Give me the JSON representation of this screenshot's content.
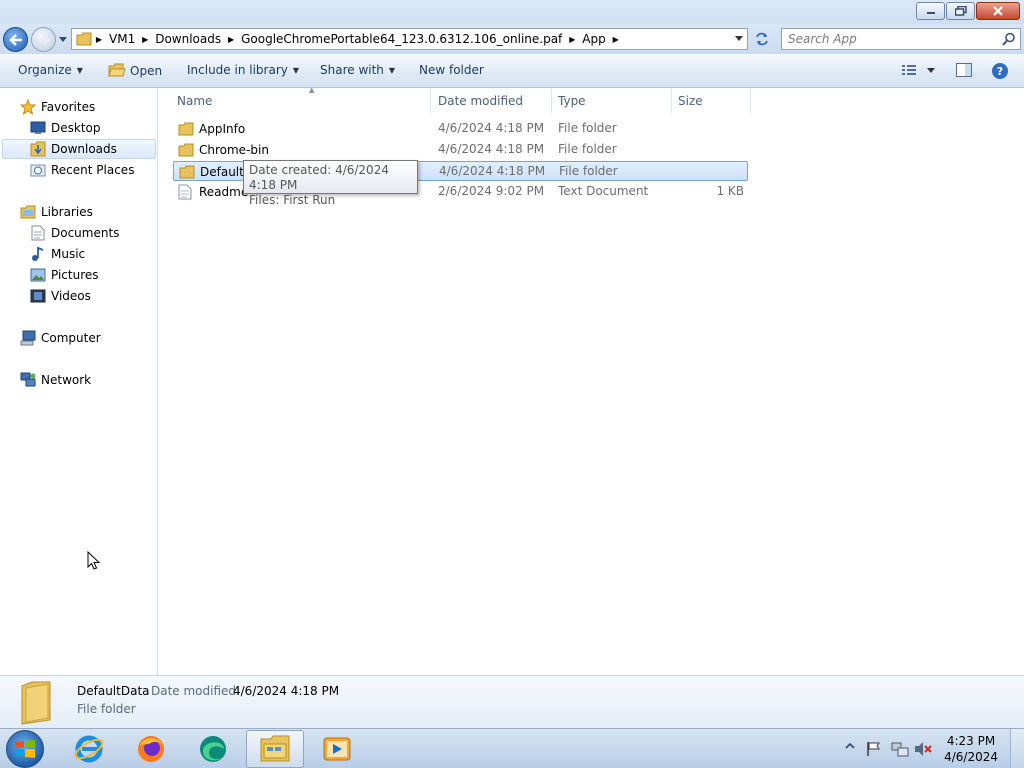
{
  "window": {
    "controls": {
      "minimize": "minimize-icon",
      "restore": "restore-icon",
      "close": "close-icon"
    }
  },
  "address": {
    "crumbs": [
      "VM1",
      "Downloads",
      "GoogleChromePortable64_123.0.6312.106_online.paf",
      "App"
    ]
  },
  "search": {
    "placeholder": "Search App"
  },
  "toolbar": {
    "organize": "Organize",
    "open": "Open",
    "include_in_library": "Include in library",
    "share_with": "Share with",
    "new_folder": "New folder"
  },
  "nav": {
    "favorites": "Favorites",
    "desktop": "Desktop",
    "downloads": "Downloads",
    "recent_places": "Recent Places",
    "libraries": "Libraries",
    "documents": "Documents",
    "music": "Music",
    "pictures": "Pictures",
    "videos": "Videos",
    "computer": "Computer",
    "network": "Network"
  },
  "columns": {
    "name": "Name",
    "date": "Date modified",
    "type": "Type",
    "size": "Size"
  },
  "files": [
    {
      "name": "AppInfo",
      "date": "4/6/2024 4:18 PM",
      "type": "File folder",
      "size": "",
      "icon": "folder-icon"
    },
    {
      "name": "Chrome-bin",
      "date": "4/6/2024 4:18 PM",
      "type": "File folder",
      "size": "",
      "icon": "folder-icon"
    },
    {
      "name": "DefaultD",
      "date": "4/6/2024 4:18 PM",
      "type": "File folder",
      "size": "",
      "icon": "folder-icon",
      "selected": true
    },
    {
      "name": "Readme",
      "date": "2/6/2024 9:02 PM",
      "type": "Text Document",
      "size": "1 KB",
      "icon": "text-document-icon"
    }
  ],
  "tooltip": {
    "line1": "Date created: 4/6/2024 4:18 PM",
    "line2": "Files: First Run"
  },
  "details": {
    "name": "DefaultData",
    "modified_label": "Date modified:",
    "modified_value": "4/6/2024 4:18 PM",
    "type": "File folder"
  },
  "taskbar": {
    "apps": [
      "internet-explorer-icon",
      "firefox-icon",
      "edge-icon",
      "file-explorer-icon",
      "media-player-icon"
    ],
    "time": "4:23 PM",
    "date": "4/6/2024"
  },
  "colors": {
    "accent": "#1e395b",
    "selection": "#cfe1f8",
    "folder": "#e8c25a"
  }
}
